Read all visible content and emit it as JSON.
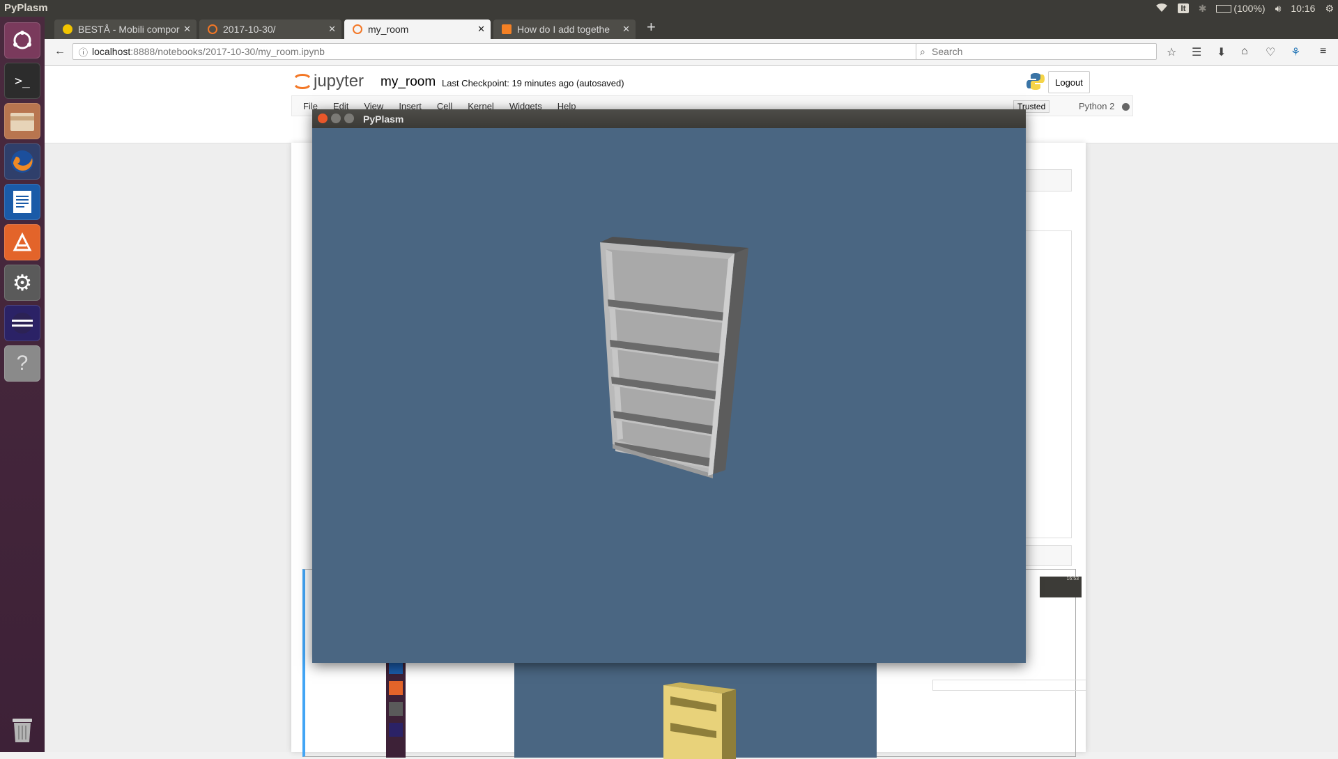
{
  "system_bar": {
    "app_title": "PyPlasm",
    "keyboard_layout": "It",
    "battery": "(100%)",
    "clock": "10:16"
  },
  "launcher": {
    "items": [
      "dash-icon",
      "terminal-icon",
      "files-icon",
      "firefox-icon",
      "writer-icon",
      "software-center-icon",
      "system-settings-icon",
      "eclipse-icon",
      "help-icon",
      "trash-icon"
    ]
  },
  "browser": {
    "tabs": [
      {
        "label": "BESTÅ - Mobili compor",
        "favicon_color": "#f2c500"
      },
      {
        "label": "2017-10-30/",
        "favicon_color": "#f37726"
      },
      {
        "label": "my_room",
        "favicon_color": "#f37726"
      },
      {
        "label": "How do I add togethe",
        "favicon_color": "#f48024"
      }
    ],
    "url_host": "localhost",
    "url_path": ":8888/notebooks/2017-10-30/my_room.ipynb",
    "search_placeholder": "Search"
  },
  "jupyter": {
    "logo_text": "jupyter",
    "notebook_name": "my_room",
    "checkpoint": "Last Checkpoint: 19 minutes ago (autosaved)",
    "logout": "Logout",
    "menu": [
      "File",
      "Edit",
      "View",
      "Insert",
      "Cell",
      "Kernel",
      "Widgets",
      "Help"
    ],
    "trusted": "Trusted",
    "kernel": "Python 2"
  },
  "pyplasm_window": {
    "title": "PyPlasm",
    "background_color": "#4a6682",
    "model": "bookcase",
    "shelf_count": 6
  },
  "embedded_screenshot": {
    "clock": "16:53"
  }
}
